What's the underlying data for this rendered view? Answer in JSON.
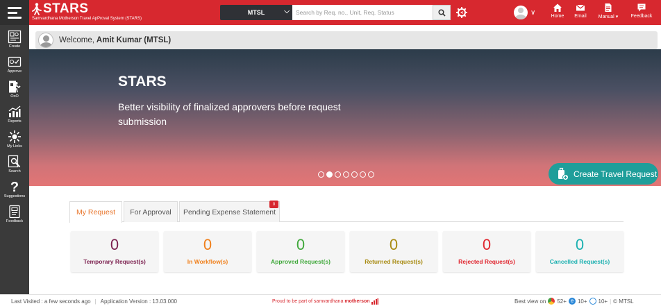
{
  "app": {
    "title": "STARS",
    "subtitle": "Samvardhana Motherson Travel ApProval System (STARS)"
  },
  "header": {
    "org_selected": "MTSL",
    "search_placeholder": "Search by Req. no., Unit, Req. Status",
    "nav": {
      "home": "Home",
      "email": "Email",
      "manual": "Manual",
      "feedback": "Feedback"
    }
  },
  "sidebar": {
    "items": [
      {
        "label": "Create",
        "icon": "create-icon"
      },
      {
        "label": "Approve",
        "icon": "approve-icon"
      },
      {
        "label": "OoO",
        "icon": "out-of-office-icon"
      },
      {
        "label": "Reports",
        "icon": "reports-icon"
      },
      {
        "label": "My Links",
        "icon": "my-links-icon"
      },
      {
        "label": "Search",
        "icon": "search-doc-icon"
      },
      {
        "label": "Suggestions",
        "icon": "question-icon"
      },
      {
        "label": "Feedback",
        "icon": "feedback-icon"
      }
    ]
  },
  "welcome": {
    "prefix": "Welcome,",
    "name": "Amit Kumar (MTSL)"
  },
  "banner": {
    "title": "STARS",
    "text": "Better visibility of finalized approvers before request submission",
    "slides_total": 7,
    "active_slide": 2,
    "cta": "Create Travel Request"
  },
  "tabs": [
    {
      "label": "My Request",
      "active": true
    },
    {
      "label": "For Approval",
      "active": false
    },
    {
      "label": "Pending Expense Statement",
      "active": false,
      "badge": "0"
    }
  ],
  "cards": [
    {
      "count": "0",
      "label": "Temporary Request(s)",
      "color": "#7b1f4e"
    },
    {
      "count": "0",
      "label": "In Workflow(s)",
      "color": "#f07f1a"
    },
    {
      "count": "0",
      "label": "Approved Request(s)",
      "color": "#3fa83a"
    },
    {
      "count": "0",
      "label": "Returned Request(s)",
      "color": "#a88b12"
    },
    {
      "count": "0",
      "label": "Rejected Request(s)",
      "color": "#e0262f"
    },
    {
      "count": "0",
      "label": "Cancelled Request(s)",
      "color": "#1ab0b0"
    }
  ],
  "footer": {
    "last_visited": "Last Visited : a few seconds ago",
    "version": "Application Version : 13.03.000",
    "proud": "Proud to be part of samvardhana",
    "brand": "motherson",
    "best_view": "Best view on",
    "chrome": "52+",
    "ie": "10+",
    "edge": "10+",
    "copyright": "© MTSL"
  },
  "colors": {
    "header_red": "#d7282f",
    "sidebar": "#3a3a3a",
    "cta_teal": "#1f9e9a",
    "tab_active": "#e8742a"
  }
}
